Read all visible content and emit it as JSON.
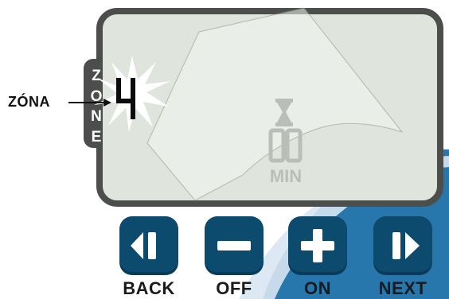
{
  "colors": {
    "accent": "#0c4a6e",
    "swoosh": "#1b6fa8",
    "lcd_bg": "#dfe5dd",
    "lcd_border": "#4b4e4b",
    "digit": "#0b0b0b",
    "faded_text": "#b9beb9"
  },
  "callout": {
    "label": "ZÓNA"
  },
  "lcd": {
    "zone_vertical_label": [
      "Z",
      "O",
      "N",
      "E"
    ],
    "zone_digit": "4",
    "timer_digits": "00",
    "timer_unit": "MIN",
    "hourglass_icon": "hourglass-icon"
  },
  "buttons": [
    {
      "id": "back",
      "label": "BACK",
      "icon": "back-icon"
    },
    {
      "id": "off",
      "label": "OFF",
      "icon": "minus-icon"
    },
    {
      "id": "on",
      "label": "ON",
      "icon": "plus-icon"
    },
    {
      "id": "next",
      "label": "NEXT",
      "icon": "next-icon"
    }
  ]
}
